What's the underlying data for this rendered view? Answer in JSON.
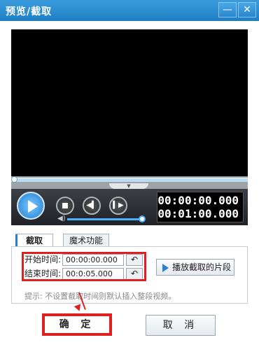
{
  "window": {
    "title": "预览/截取",
    "minimize_glyph": "—",
    "close_glyph": "✕"
  },
  "player": {
    "seek_progress": 0,
    "volume_level": 0.95,
    "current_time": "00:00:00.000",
    "total_time": "00:01:00.000",
    "icons": [
      "play-icon",
      "stop-icon",
      "prev-frame-icon",
      "next-frame-icon",
      "volume-icon"
    ]
  },
  "tabs": [
    {
      "label": "截取",
      "active": true
    },
    {
      "label": "魔术功能",
      "active": false
    }
  ],
  "cut": {
    "start_label": "开始时间:",
    "start_value": "00:00:00.000",
    "end_label": "结束时间:",
    "end_value": "00:0:05.000",
    "reset_glyph": "↶",
    "play_clip_label": "播放截取的片段",
    "tip": "提示: 不设置截取时间则默认插入整段视频。"
  },
  "buttons": {
    "ok": "确 定",
    "cancel": "取 消"
  },
  "colors": {
    "titlebar": "#2a8ad2",
    "accent": "#2a7fd0",
    "highlight": "#e02020"
  }
}
